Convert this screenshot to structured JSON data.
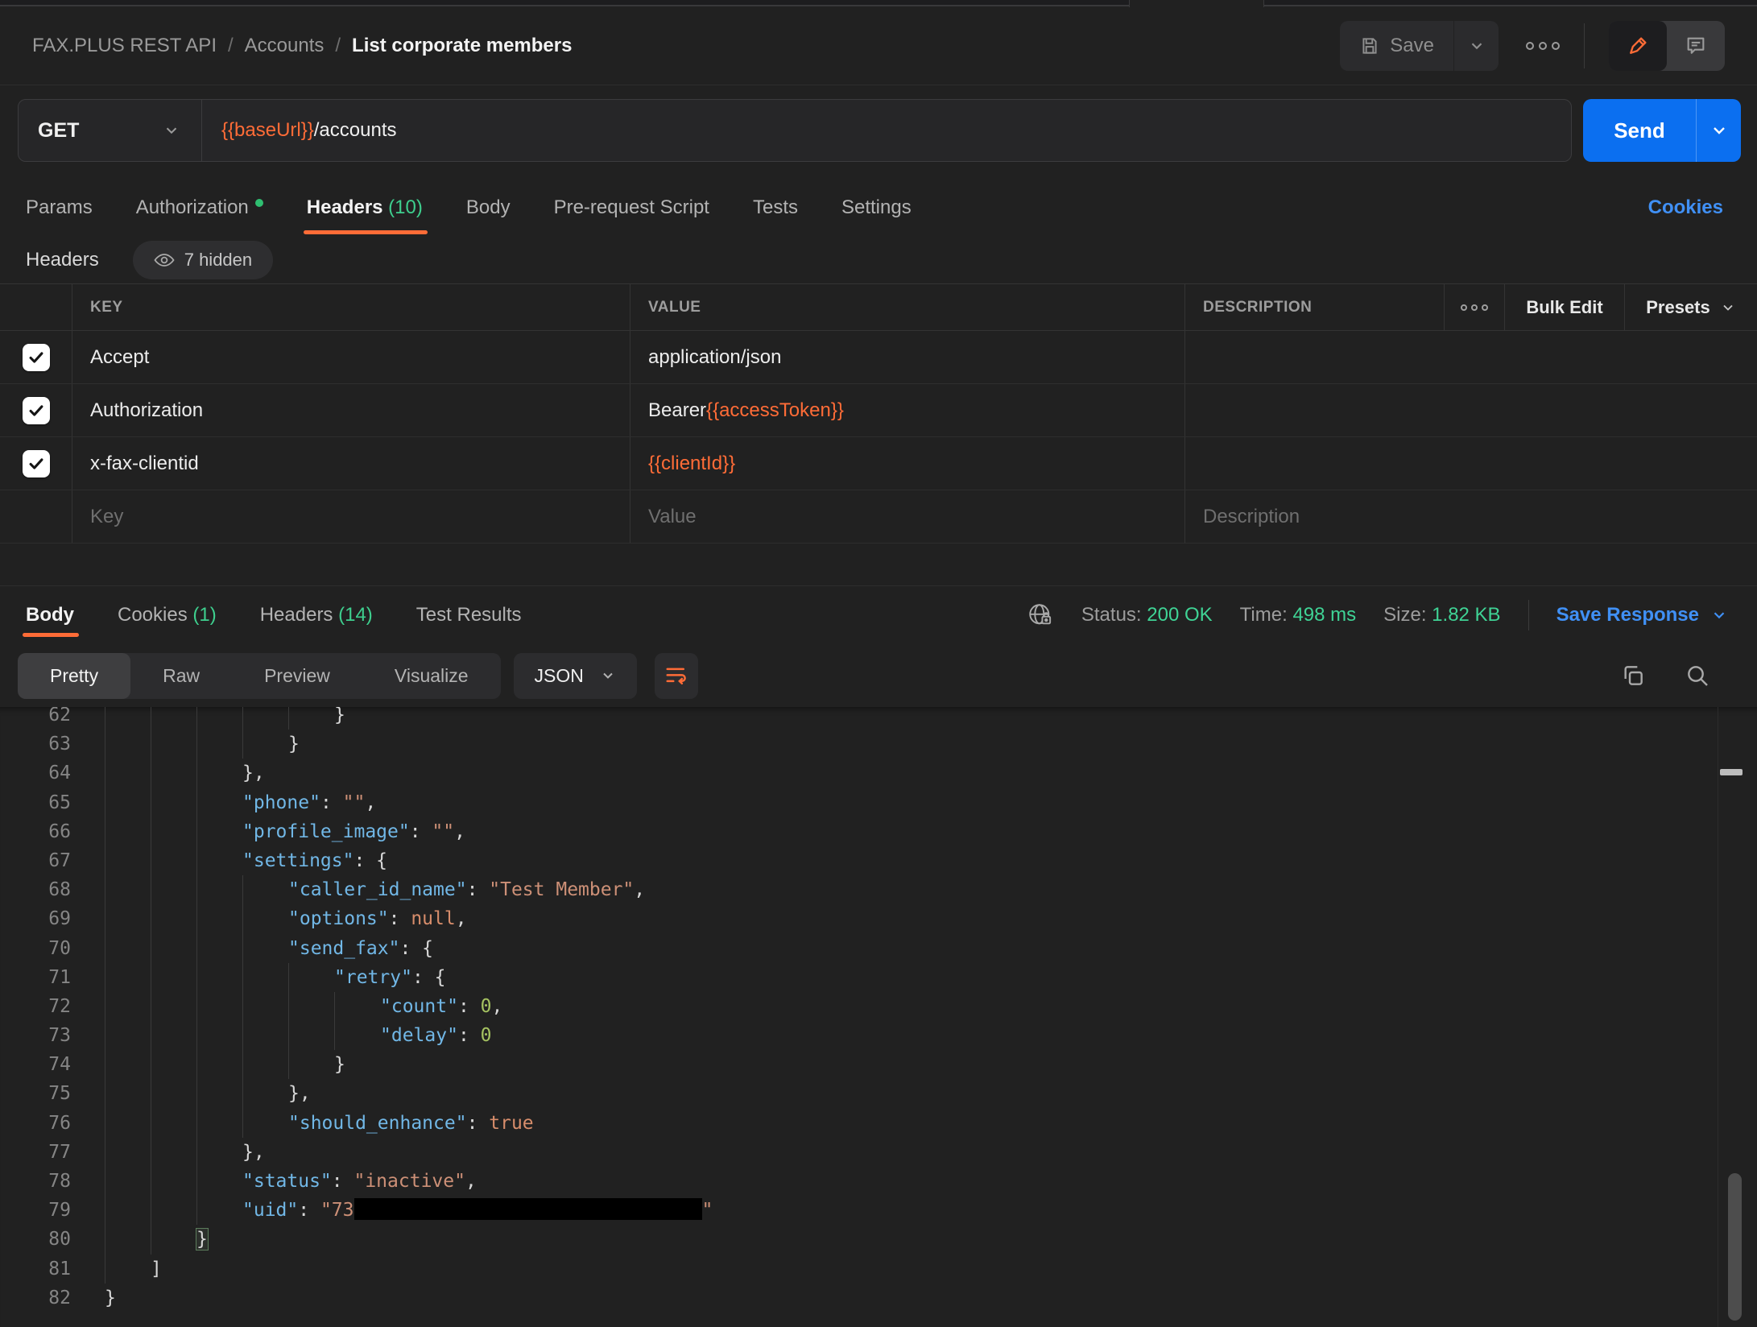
{
  "window": {
    "breadcrumb": [
      "FAX.PLUS REST API",
      "Accounts",
      "List corporate members"
    ],
    "separator": "/",
    "save_label": "Save"
  },
  "request": {
    "method": "GET",
    "url_variable": "{{baseUrl}}",
    "url_path": "/accounts",
    "send_label": "Send"
  },
  "request_tabs": [
    {
      "label": "Params"
    },
    {
      "label": "Authorization",
      "dot": true
    },
    {
      "label": "Headers",
      "count": "(10)",
      "active": true
    },
    {
      "label": "Body"
    },
    {
      "label": "Pre-request Script"
    },
    {
      "label": "Tests"
    },
    {
      "label": "Settings"
    }
  ],
  "cookies_link": "Cookies",
  "headers_section": {
    "title": "Headers",
    "hidden_badge": "7 hidden"
  },
  "headers_table": {
    "columns": [
      "KEY",
      "VALUE",
      "DESCRIPTION"
    ],
    "bulk_edit_label": "Bulk Edit",
    "presets_label": "Presets",
    "rows": [
      {
        "key": "Accept",
        "checked": true,
        "value": [
          {
            "text": "application/json",
            "var": false
          }
        ]
      },
      {
        "key": "Authorization",
        "checked": true,
        "value": [
          {
            "text": "Bearer ",
            "var": false
          },
          {
            "text": "{{accessToken}}",
            "var": true
          }
        ]
      },
      {
        "key": "x-fax-clientid",
        "checked": true,
        "value": [
          {
            "text": "{{clientId}}",
            "var": true
          }
        ]
      }
    ],
    "placeholder_row": {
      "key": "Key",
      "value": "Value",
      "description": "Description"
    }
  },
  "response": {
    "tabs": [
      {
        "label": "Body",
        "active": true
      },
      {
        "label": "Cookies",
        "count": "(1)"
      },
      {
        "label": "Headers",
        "count": "(14)"
      },
      {
        "label": "Test Results"
      }
    ],
    "status_label": "Status:",
    "status_value": "200 OK",
    "time_label": "Time:",
    "time_value": "498 ms",
    "size_label": "Size:",
    "size_value": "1.82 KB",
    "save_response_label": "Save Response"
  },
  "viewer": {
    "modes": [
      "Pretty",
      "Raw",
      "Preview",
      "Visualize"
    ],
    "active_mode": "Pretty",
    "language": "JSON"
  },
  "code": {
    "lines": [
      {
        "n": 62,
        "i": 5,
        "parts": [
          [
            "p",
            "}"
          ]
        ]
      },
      {
        "n": 63,
        "i": 4,
        "parts": [
          [
            "p",
            "}"
          ]
        ]
      },
      {
        "n": 64,
        "i": 3,
        "parts": [
          [
            "p",
            "},"
          ]
        ]
      },
      {
        "n": 65,
        "i": 3,
        "parts": [
          [
            "k",
            "\"phone\""
          ],
          [
            "p",
            ": "
          ],
          [
            "s",
            "\"\""
          ],
          [
            "p",
            ","
          ]
        ]
      },
      {
        "n": 66,
        "i": 3,
        "parts": [
          [
            "k",
            "\"profile_image\""
          ],
          [
            "p",
            ": "
          ],
          [
            "s",
            "\"\""
          ],
          [
            "p",
            ","
          ]
        ]
      },
      {
        "n": 67,
        "i": 3,
        "parts": [
          [
            "k",
            "\"settings\""
          ],
          [
            "p",
            ": {"
          ]
        ]
      },
      {
        "n": 68,
        "i": 4,
        "parts": [
          [
            "k",
            "\"caller_id_name\""
          ],
          [
            "p",
            ": "
          ],
          [
            "s",
            "\"Test Member\""
          ],
          [
            "p",
            ","
          ]
        ]
      },
      {
        "n": 69,
        "i": 4,
        "parts": [
          [
            "k",
            "\"options\""
          ],
          [
            "p",
            ": "
          ],
          [
            "c",
            "null"
          ],
          [
            "p",
            ","
          ]
        ]
      },
      {
        "n": 70,
        "i": 4,
        "parts": [
          [
            "k",
            "\"send_fax\""
          ],
          [
            "p",
            ": {"
          ]
        ]
      },
      {
        "n": 71,
        "i": 5,
        "parts": [
          [
            "k",
            "\"retry\""
          ],
          [
            "p",
            ": {"
          ]
        ]
      },
      {
        "n": 72,
        "i": 6,
        "parts": [
          [
            "k",
            "\"count\""
          ],
          [
            "p",
            ": "
          ],
          [
            "num",
            "0"
          ],
          [
            "p",
            ","
          ]
        ]
      },
      {
        "n": 73,
        "i": 6,
        "parts": [
          [
            "k",
            "\"delay\""
          ],
          [
            "p",
            ": "
          ],
          [
            "num",
            "0"
          ]
        ]
      },
      {
        "n": 74,
        "i": 5,
        "parts": [
          [
            "p",
            "}"
          ]
        ]
      },
      {
        "n": 75,
        "i": 4,
        "parts": [
          [
            "p",
            "},"
          ]
        ]
      },
      {
        "n": 76,
        "i": 4,
        "parts": [
          [
            "k",
            "\"should_enhance\""
          ],
          [
            "p",
            ": "
          ],
          [
            "c",
            "true"
          ]
        ]
      },
      {
        "n": 77,
        "i": 3,
        "parts": [
          [
            "p",
            "},"
          ]
        ]
      },
      {
        "n": 78,
        "i": 3,
        "parts": [
          [
            "k",
            "\"status\""
          ],
          [
            "p",
            ": "
          ],
          [
            "s",
            "\"inactive\""
          ],
          [
            "p",
            ","
          ]
        ]
      },
      {
        "n": 79,
        "i": 3,
        "parts": [
          [
            "k",
            "\"uid\""
          ],
          [
            "p",
            ": "
          ],
          [
            "s",
            "\"73"
          ],
          [
            "redact",
            ""
          ],
          [
            "s",
            "\""
          ]
        ]
      },
      {
        "n": 80,
        "i": 2,
        "parts": [
          [
            "hl",
            "}"
          ]
        ]
      },
      {
        "n": 81,
        "i": 1,
        "parts": [
          [
            "p",
            "]"
          ]
        ]
      },
      {
        "n": 82,
        "i": 0,
        "parts": [
          [
            "p",
            "}"
          ]
        ]
      }
    ]
  },
  "colors": {
    "accent_orange": "#ff6c37",
    "green": "#3ecf8e",
    "link_blue": "#4090f5",
    "send_blue": "#0b6ff0"
  }
}
